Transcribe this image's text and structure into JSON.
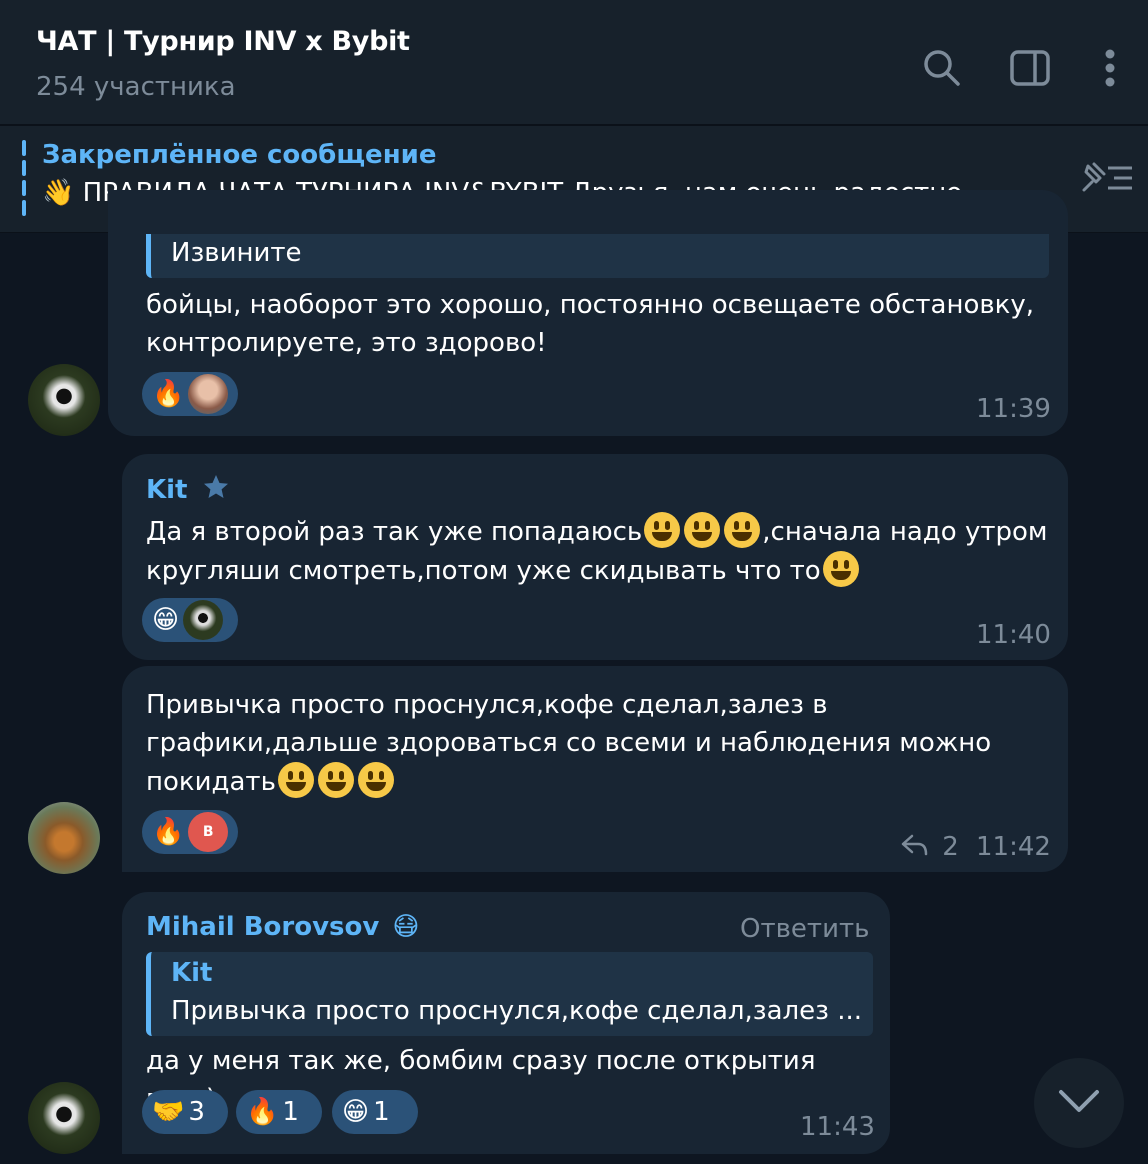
{
  "header": {
    "title": "ЧАТ | Турнир INV x Bybit",
    "subtitle": "254 участника"
  },
  "pinned": {
    "title": "Закреплённое сообщение",
    "text": "👋 ПРАВИЛА ЧАТА ТУРНИРА INV&BYBIT  Друзья, нам очень радостно ..."
  },
  "messages": [
    {
      "reply_text": "Извините",
      "text": "бойцы, наоборот это хорошо, постоянно освещаете обстановку, контролируете, это здорово!",
      "time": "11:39"
    },
    {
      "sender": "Kit",
      "text_line1": "Да я второй раз так уже попадаюсь",
      "text_line1b": ",сначала надо утром",
      "text_line2": "кругляши смотреть,потом уже скидывать что то",
      "time": "11:40"
    },
    {
      "text_line1": "Привычка просто проснулся,кофе сделал,залез в",
      "text_line2": "графики,дальше здороваться со всеми и наблюдения можно",
      "text_line3": "покидать",
      "reactor_initial": "В",
      "replies_count": "2",
      "time": "11:42"
    },
    {
      "sender": "Mihail Borovsov",
      "reply_action": "Ответить",
      "reply_sender": "Kit",
      "reply_text": "Привычка просто проснулся,кофе сделал,залез ...",
      "text": "да у меня так же, бомбим сразу после открытия глаз)",
      "reactions": [
        {
          "emoji": "🤝",
          "count": "3"
        },
        {
          "emoji": "🔥",
          "count": "1"
        },
        {
          "emoji": "😁",
          "count": "1"
        }
      ],
      "time": "11:43"
    }
  ],
  "colors": {
    "background": "#0e1621",
    "header": "#17212b",
    "bubble": "#182533",
    "accent": "#5eb5f7",
    "reaction": "#2b5278"
  }
}
